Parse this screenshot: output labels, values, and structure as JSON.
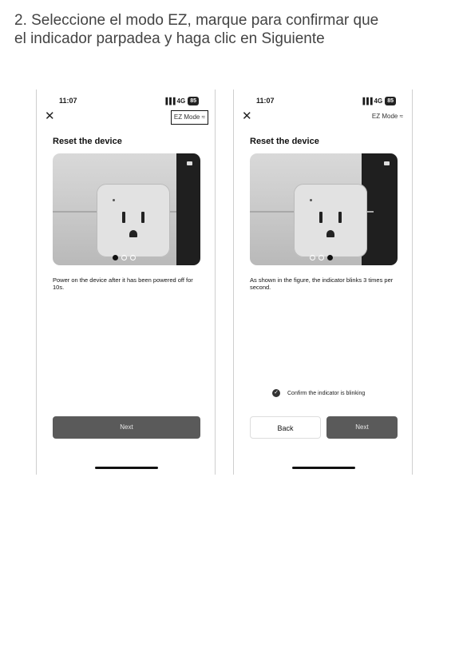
{
  "heading": {
    "line1": "2. Seleccione el modo EZ, marque para confirmar que",
    "line2": "el indicador parpadea y haga clic en Siguiente"
  },
  "phones": [
    {
      "time": "11:07",
      "network": "4G",
      "battery": "85",
      "mode_label": "EZ Mode ≈",
      "mode_highlighted": true,
      "title": "Reset the device",
      "description": "Power on the device after it has been powered off for 10s.",
      "page_indicator_active": 1,
      "next_label": "Next"
    },
    {
      "time": "11:07",
      "network": "4G",
      "battery": "85",
      "mode_label": "EZ Mode ≈",
      "mode_highlighted": false,
      "title": "Reset the device",
      "description": "As shown in the figure, the indicator blinks 3 times per second.",
      "confirm_label": "Confirm the indicator is blinking",
      "page_indicator_active": 3,
      "back_label": "Back",
      "next_label": "Next"
    }
  ],
  "icons": {
    "close": "close-icon",
    "signal": "signal-icon",
    "battery": "battery-icon",
    "camera": "camera-icon",
    "check": "check-icon"
  },
  "colors": {
    "button_primary": "#5a5a5a",
    "heading_text": "#444444"
  }
}
